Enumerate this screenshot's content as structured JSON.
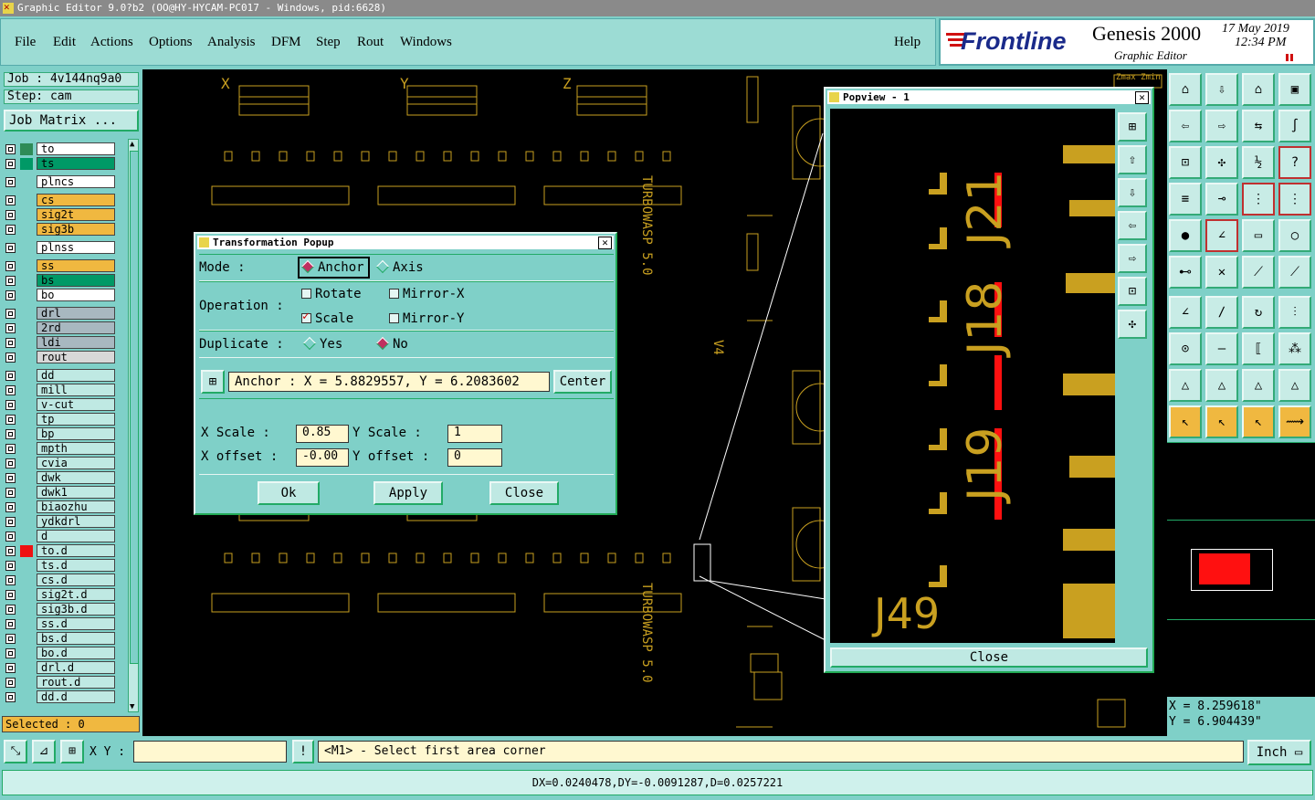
{
  "window": {
    "title": "Graphic Editor 9.0?b2 (OO@HY-HYCAM-PC017 - Windows, pid:6628)"
  },
  "menu": [
    "File",
    "Edit",
    "Actions",
    "Options",
    "Analysis",
    "DFM",
    "Step",
    "Rout",
    "Windows"
  ],
  "help": "Help",
  "brand": {
    "logo": "Frontline",
    "product": "Genesis 2000",
    "subtitle": "Graphic Editor",
    "date": "17 May 2019",
    "time": "12:34 PM"
  },
  "job": {
    "job": "Job : 4v144nq9a0",
    "step": "Step: cam",
    "matrix_button": "Job Matrix ..."
  },
  "layers": [
    {
      "name": "to",
      "color": "#2e8b57",
      "label_bg": "#ffffff"
    },
    {
      "name": "ts",
      "color": "#009966",
      "label_bg": "#009966"
    },
    {
      "name": "plncs",
      "color": "",
      "label_bg": "#ffffff"
    },
    {
      "name": "cs",
      "color": "",
      "label_bg": "#f0b840"
    },
    {
      "name": "sig2t",
      "color": "",
      "label_bg": "#f0b840"
    },
    {
      "name": "sig3b",
      "color": "",
      "label_bg": "#f0b840"
    },
    {
      "name": "plnss",
      "color": "",
      "label_bg": "#ffffff"
    },
    {
      "name": "ss",
      "color": "",
      "label_bg": "#f0b840"
    },
    {
      "name": "bs",
      "color": "",
      "label_bg": "#009966"
    },
    {
      "name": "bo",
      "color": "",
      "label_bg": "#ffffff"
    },
    {
      "name": "drl",
      "color": "",
      "label_bg": "#a8b8c0"
    },
    {
      "name": "2rd",
      "color": "",
      "label_bg": "#a8b8c0"
    },
    {
      "name": "ldi",
      "color": "",
      "label_bg": "#a8b8c0"
    },
    {
      "name": "rout",
      "color": "",
      "label_bg": "#d8d8d8"
    },
    {
      "name": "dd",
      "color": "",
      "label_bg": "#bfe9e3"
    },
    {
      "name": "mill",
      "color": "",
      "label_bg": "#bfe9e3"
    },
    {
      "name": "v-cut",
      "color": "",
      "label_bg": "#bfe9e3"
    },
    {
      "name": "tp",
      "color": "",
      "label_bg": "#bfe9e3"
    },
    {
      "name": "bp",
      "color": "",
      "label_bg": "#bfe9e3"
    },
    {
      "name": "mpth",
      "color": "",
      "label_bg": "#bfe9e3"
    },
    {
      "name": "cvia",
      "color": "",
      "label_bg": "#bfe9e3"
    },
    {
      "name": "dwk",
      "color": "",
      "label_bg": "#bfe9e3"
    },
    {
      "name": "dwk1",
      "color": "",
      "label_bg": "#bfe9e3"
    },
    {
      "name": "biaozhu",
      "color": "",
      "label_bg": "#bfe9e3"
    },
    {
      "name": "ydkdrl",
      "color": "",
      "label_bg": "#bfe9e3"
    },
    {
      "name": "d",
      "color": "",
      "label_bg": "#bfe9e3"
    },
    {
      "name": "to.d",
      "color": "#ee1111",
      "label_bg": "#bfe9e3"
    },
    {
      "name": "ts.d",
      "color": "",
      "label_bg": "#bfe9e3"
    },
    {
      "name": "cs.d",
      "color": "",
      "label_bg": "#bfe9e3"
    },
    {
      "name": "sig2t.d",
      "color": "",
      "label_bg": "#bfe9e3"
    },
    {
      "name": "sig3b.d",
      "color": "",
      "label_bg": "#bfe9e3"
    },
    {
      "name": "ss.d",
      "color": "",
      "label_bg": "#bfe9e3"
    },
    {
      "name": "bs.d",
      "color": "",
      "label_bg": "#bfe9e3"
    },
    {
      "name": "bo.d",
      "color": "",
      "label_bg": "#bfe9e3"
    },
    {
      "name": "drl.d",
      "color": "",
      "label_bg": "#bfe9e3"
    },
    {
      "name": "rout.d",
      "color": "",
      "label_bg": "#bfe9e3"
    },
    {
      "name": "dd.d",
      "color": "",
      "label_bg": "#bfe9e3"
    }
  ],
  "selected": "Selected : 0",
  "transform": {
    "title": "Transformation Popup",
    "mode_label": "Mode        :",
    "mode_anchor": "Anchor",
    "mode_axis": "Axis",
    "operation_label": "Operation :",
    "op_rotate": "Rotate",
    "op_mirror_x": "Mirror-X",
    "op_scale": "Scale",
    "op_mirror_y": "Mirror-Y",
    "duplicate_label": "Duplicate :",
    "dup_yes": "Yes",
    "dup_no": "No",
    "anchor_text": "Anchor :  X = 5.8829557, Y = 6.2083602",
    "center_button": "Center",
    "x_scale_label": "X Scale   :",
    "x_scale_value": "0.85",
    "y_scale_label": "Y Scale   :",
    "y_scale_value": "1",
    "x_offset_label": "X offset :",
    "x_offset_value": "-0.00",
    "y_offset_label": "Y offset :",
    "y_offset_value": "0",
    "ok": "Ok",
    "apply": "Apply",
    "close": "Close"
  },
  "popview": {
    "title": "Popview - 1",
    "close": "Close"
  },
  "canvas_labels": {
    "x": "X",
    "y": "Y",
    "z": "Z",
    "turbo1": "TURBOWASP 5.0",
    "turbo2": "TURBOWASP 5.0",
    "v4": "V4",
    "j49": "J49",
    "j21": "J21",
    "j18": "J18",
    "j19": "J19",
    "zmax": "Zmax Zmin"
  },
  "coords": {
    "x": "X = 8.259618\"",
    "y": "Y = 6.904439\""
  },
  "cmd": {
    "xy_label": "X Y :",
    "prompt": "<M1> - Select first area corner",
    "units": "Inch"
  },
  "status": "DX=0.0240478,DY=-0.0091287,D=0.0257221",
  "colors": {
    "panel": "#7fd0c8",
    "gold": "#c9a020",
    "red": "#ff1010",
    "brand_red": "#d01010",
    "brand_blue": "#1a2a8a"
  }
}
